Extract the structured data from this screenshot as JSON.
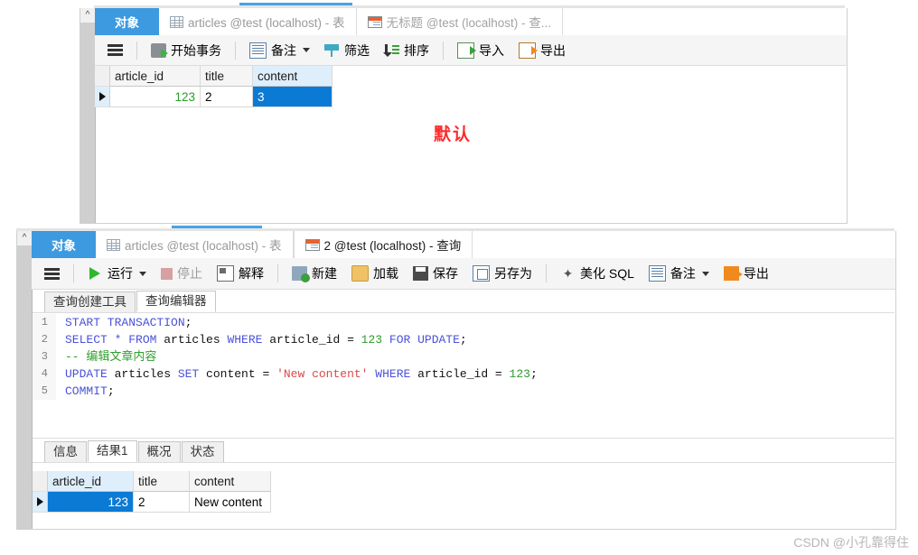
{
  "panel_top": {
    "gutter": {
      "chevron_icon": "chevron-up-icon"
    },
    "tabs": [
      {
        "label": "对象",
        "icon": null,
        "state": "object-nav"
      },
      {
        "label": "articles @test (localhost) - 表",
        "icon": "table-icon",
        "state": "inactive"
      },
      {
        "label": "无标题 @test (localhost) - 查...",
        "icon": "query-icon",
        "state": "inactive"
      }
    ],
    "toolbar": [
      {
        "label": "",
        "icon": "hamburger-icon",
        "name": "menu-button"
      },
      {
        "label": "开始事务",
        "icon": "begin-transaction-icon",
        "name": "begin-transaction-button"
      },
      {
        "label": "备注",
        "icon": "note-icon",
        "name": "note-button",
        "dropdown": true
      },
      {
        "label": "筛选",
        "icon": "filter-icon",
        "name": "filter-button"
      },
      {
        "label": "排序",
        "icon": "sort-icon",
        "name": "sort-button"
      },
      {
        "label": "导入",
        "icon": "import-icon",
        "name": "import-button"
      },
      {
        "label": "导出",
        "icon": "export-icon",
        "name": "export-button"
      }
    ],
    "grid": {
      "columns": [
        "article_id",
        "title",
        "content"
      ],
      "selected_column": "content",
      "rows": [
        {
          "article_id": "123",
          "title": "2",
          "content": "3",
          "selected_cell": "content"
        }
      ]
    }
  },
  "annotation": {
    "text": "默认",
    "color": "#ff2a2a"
  },
  "panel_bottom": {
    "gutter": {
      "chevron_icon": "chevron-up-icon"
    },
    "tabs": [
      {
        "label": "对象",
        "icon": null,
        "state": "object-nav"
      },
      {
        "label": "articles @test (localhost) - 表",
        "icon": "table-icon",
        "state": "inactive"
      },
      {
        "label": "2 @test (localhost) - 查询",
        "icon": "query-icon",
        "state": "active"
      }
    ],
    "toolbar": [
      {
        "label": "",
        "icon": "hamburger-icon",
        "name": "menu-button"
      },
      {
        "label": "运行",
        "icon": "run-icon",
        "name": "run-button",
        "dropdown": true
      },
      {
        "label": "停止",
        "icon": "stop-icon",
        "name": "stop-button",
        "disabled": true
      },
      {
        "label": "解释",
        "icon": "explain-icon",
        "name": "explain-button"
      },
      {
        "label": "新建",
        "icon": "new-icon",
        "name": "new-button"
      },
      {
        "label": "加载",
        "icon": "load-icon",
        "name": "load-button"
      },
      {
        "label": "保存",
        "icon": "save-icon",
        "name": "save-button"
      },
      {
        "label": "另存为",
        "icon": "save-as-icon",
        "name": "save-as-button"
      },
      {
        "label": "美化 SQL",
        "icon": "beautify-icon",
        "name": "beautify-sql-button"
      },
      {
        "label": "备注",
        "icon": "note-icon",
        "name": "note-button",
        "dropdown": true
      },
      {
        "label": "导出",
        "icon": "export-icon",
        "name": "export-button"
      }
    ],
    "editor_tabs": [
      {
        "label": "查询创建工具",
        "active": false
      },
      {
        "label": "查询编辑器",
        "active": true
      }
    ],
    "sql_lines": [
      {
        "no": "1",
        "tokens": [
          {
            "t": "START TRANSACTION",
            "c": "kw"
          },
          {
            "t": ";",
            "c": "pln"
          }
        ]
      },
      {
        "no": "2",
        "tokens": [
          {
            "t": "SELECT * FROM ",
            "c": "kw"
          },
          {
            "t": "articles ",
            "c": "pln"
          },
          {
            "t": "WHERE ",
            "c": "kw"
          },
          {
            "t": "article_id = ",
            "c": "pln"
          },
          {
            "t": "123",
            "c": "num"
          },
          {
            "t": " ",
            "c": "pln"
          },
          {
            "t": "FOR UPDATE",
            "c": "kw"
          },
          {
            "t": ";",
            "c": "pln"
          }
        ]
      },
      {
        "no": "3",
        "tokens": [
          {
            "t": "-- 编辑文章内容",
            "c": "cmt"
          }
        ]
      },
      {
        "no": "4",
        "tokens": [
          {
            "t": "UPDATE ",
            "c": "kw"
          },
          {
            "t": "articles ",
            "c": "pln"
          },
          {
            "t": "SET ",
            "c": "kw"
          },
          {
            "t": "content = ",
            "c": "pln"
          },
          {
            "t": "'New content'",
            "c": "str"
          },
          {
            "t": " ",
            "c": "pln"
          },
          {
            "t": "WHERE ",
            "c": "kw"
          },
          {
            "t": "article_id = ",
            "c": "pln"
          },
          {
            "t": "123",
            "c": "num"
          },
          {
            "t": ";",
            "c": "pln"
          }
        ]
      },
      {
        "no": "5",
        "tokens": [
          {
            "t": "COMMIT",
            "c": "kw"
          },
          {
            "t": ";",
            "c": "pln"
          }
        ]
      }
    ],
    "result_tabs": [
      {
        "label": "信息",
        "active": false
      },
      {
        "label": "结果1",
        "active": true
      },
      {
        "label": "概况",
        "active": false
      },
      {
        "label": "状态",
        "active": false
      }
    ],
    "result_grid": {
      "columns": [
        "article_id",
        "title",
        "content"
      ],
      "selected_column": "article_id",
      "rows": [
        {
          "article_id": "123",
          "title": "2",
          "content": "New content",
          "selected_cell": "article_id"
        }
      ]
    }
  },
  "watermark": {
    "text": "CSDN @小孔靠得住"
  }
}
